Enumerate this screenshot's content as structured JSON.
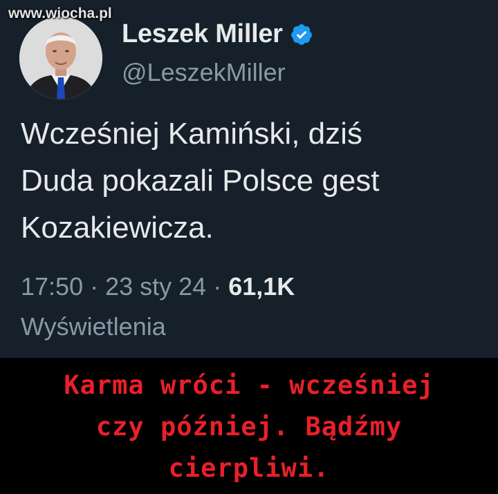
{
  "watermark": "www.wiocha.pl",
  "profile": {
    "display_name": "Leszek Miller",
    "handle": "@LeszekMiller",
    "verified_icon": "verified-badge-icon"
  },
  "tweet": {
    "lines": [
      "Wcześniej Kamiński, dziś",
      "Duda pokazali Polsce gest",
      "Kozakiewicza."
    ],
    "time": "17:50",
    "date": "23 sty 24",
    "views_count": "61,1K",
    "views_label": "Wyświetlenia"
  },
  "caption": {
    "lines": [
      "Karma wróci - wcześniej",
      "czy później. Bądźmy",
      "cierpliwi."
    ]
  },
  "colors": {
    "tweet_background": "#15202b",
    "caption_text": "#e8202a",
    "verified": "#1d9bf0"
  }
}
